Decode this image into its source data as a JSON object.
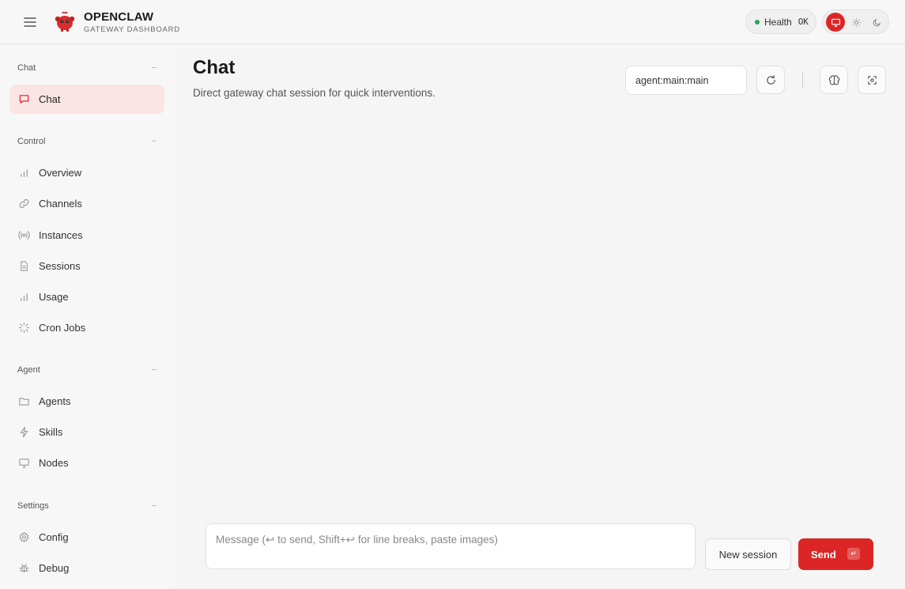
{
  "header": {
    "brand_title": "OPENCLAW",
    "brand_subtitle": "GATEWAY DASHBOARD",
    "health_label": "Health",
    "health_status": "OK",
    "theme_options": [
      "monitor-icon",
      "sun-icon",
      "moon-icon"
    ],
    "accent_color": "#dc2626"
  },
  "sidebar": {
    "sections": [
      {
        "label": "Chat",
        "collapse": "−",
        "items": [
          {
            "label": "Chat",
            "icon": "chat-bubble-icon",
            "active": true
          }
        ]
      },
      {
        "label": "Control",
        "collapse": "−",
        "items": [
          {
            "label": "Overview",
            "icon": "bar-chart-icon"
          },
          {
            "label": "Channels",
            "icon": "link-icon"
          },
          {
            "label": "Instances",
            "icon": "radio-icon"
          },
          {
            "label": "Sessions",
            "icon": "document-icon"
          },
          {
            "label": "Usage",
            "icon": "bar-chart-icon"
          },
          {
            "label": "Cron Jobs",
            "icon": "loader-icon"
          }
        ]
      },
      {
        "label": "Agent",
        "collapse": "−",
        "items": [
          {
            "label": "Agents",
            "icon": "folder-icon"
          },
          {
            "label": "Skills",
            "icon": "lightning-icon"
          },
          {
            "label": "Nodes",
            "icon": "monitor-icon"
          }
        ]
      },
      {
        "label": "Settings",
        "collapse": "−",
        "items": [
          {
            "label": "Config",
            "icon": "gear-icon"
          },
          {
            "label": "Debug",
            "icon": "bug-icon"
          }
        ]
      }
    ]
  },
  "main": {
    "title": "Chat",
    "subtitle": "Direct gateway chat session for quick interventions.",
    "session_key": "agent:main:main",
    "composer_placeholder": "Message (↩ to send, Shift+↩ for line breaks, paste images)",
    "new_session_label": "New session",
    "send_label": "Send",
    "send_shortcut": "↵"
  }
}
